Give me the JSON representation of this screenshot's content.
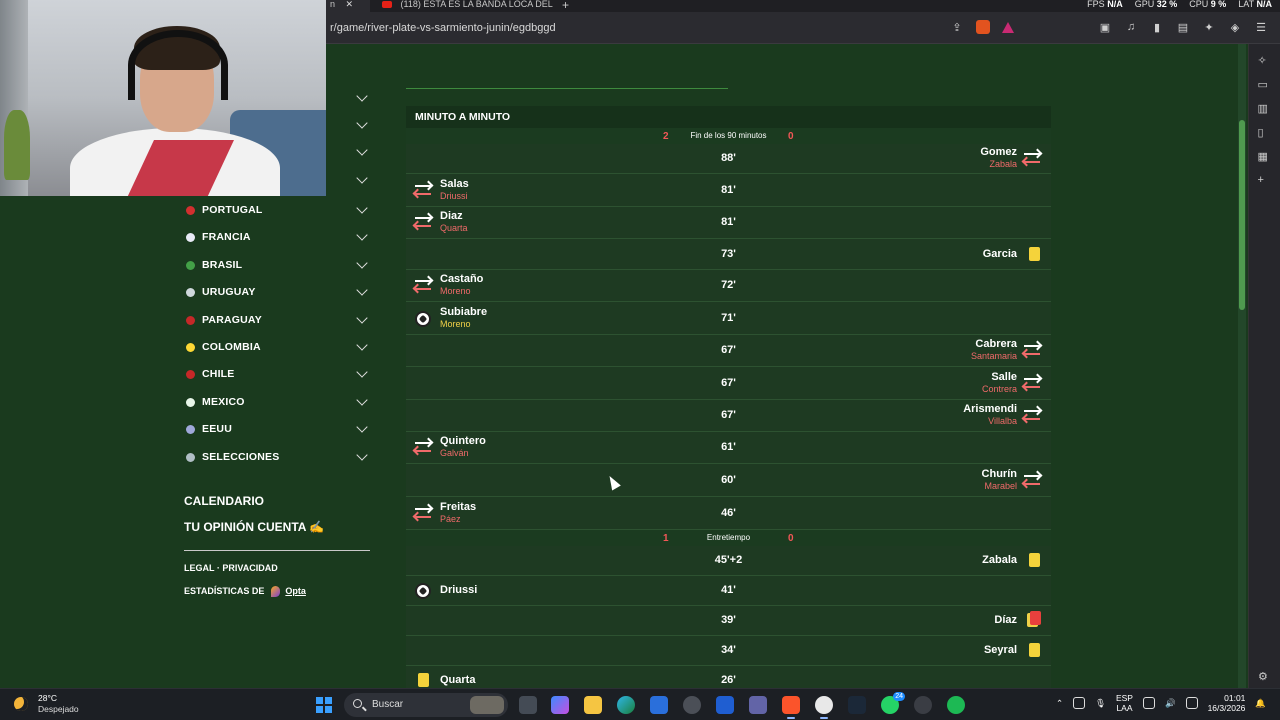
{
  "browser": {
    "tabs": [
      {
        "label": "n",
        "active": true
      },
      {
        "label": "(118) ESTA ES LA BANDA LOCA DEL",
        "active": false
      }
    ],
    "url": "r/game/river-plate-vs-sarmiento-junin/egdbggd",
    "stats": {
      "fps_label": "FPS",
      "fps_value": "N/A",
      "gpu_label": "GPU",
      "gpu_value": "32 %",
      "cpu_label": "CPU",
      "cpu_value": "9 %",
      "lat_label": "LAT",
      "lat_value": "N/A"
    }
  },
  "leftnav": {
    "countries": [
      {
        "label": "PORTUGAL",
        "flag_color": "#d32f2f"
      },
      {
        "label": "FRANCIA",
        "flag_color": "#e8eaf6"
      },
      {
        "label": "BRASIL",
        "flag_color": "#43a047"
      },
      {
        "label": "URUGUAY",
        "flag_color": "#cfd8dc"
      },
      {
        "label": "PARAGUAY",
        "flag_color": "#c62828"
      },
      {
        "label": "COLOMBIA",
        "flag_color": "#fdd835"
      },
      {
        "label": "CHILE",
        "flag_color": "#c62828"
      },
      {
        "label": "MEXICO",
        "flag_color": "#e8f5e9"
      },
      {
        "label": "EEUU",
        "flag_color": "#9fa8da"
      },
      {
        "label": "SELECCIONES",
        "flag_color": "#b0bec5"
      }
    ],
    "calendario": "CALENDARIO",
    "opinion": "TU OPINIÓN CUENTA ✍️",
    "legal": "LEGAL",
    "privacidad": "PRIVACIDAD",
    "stats_by": "ESTADÍSTICAS DE",
    "opta": "Opta"
  },
  "feed": {
    "title": "MINUTO A MINUTO",
    "final": {
      "home": "2",
      "label": "Fin de los 90 minutos",
      "away": "0"
    },
    "halftime": {
      "home": "1",
      "label": "Entretiempo",
      "away": "0"
    },
    "events_a": [
      {
        "min": "88'",
        "side": "away",
        "type": "sub",
        "player": "Gomez",
        "secondary": "Zabala"
      },
      {
        "min": "81'",
        "side": "home",
        "type": "sub",
        "player": "Salas",
        "secondary": "Driussi"
      },
      {
        "min": "81'",
        "side": "home",
        "type": "sub",
        "player": "Diaz",
        "secondary": "Quarta"
      },
      {
        "min": "73'",
        "side": "away",
        "type": "yellow",
        "player": "Garcia",
        "secondary": ""
      },
      {
        "min": "72'",
        "side": "home",
        "type": "sub",
        "player": "Castaño",
        "secondary": "Moreno"
      },
      {
        "min": "71'",
        "side": "home",
        "type": "goal",
        "player": "Subiabre",
        "secondary": "Moreno"
      },
      {
        "min": "67'",
        "side": "away",
        "type": "sub",
        "player": "Cabrera",
        "secondary": "Santamaria"
      },
      {
        "min": "67'",
        "side": "away",
        "type": "sub",
        "player": "Salle",
        "secondary": "Contrera"
      },
      {
        "min": "67'",
        "side": "away",
        "type": "sub",
        "player": "Arismendi",
        "secondary": "Villalba"
      },
      {
        "min": "61'",
        "side": "home",
        "type": "sub",
        "player": "Quintero",
        "secondary": "Galván"
      },
      {
        "min": "60'",
        "side": "away",
        "type": "sub",
        "player": "Churín",
        "secondary": "Marabel"
      },
      {
        "min": "46'",
        "side": "home",
        "type": "sub",
        "player": "Freitas",
        "secondary": "Páez"
      }
    ],
    "events_b": [
      {
        "min": "45'+2",
        "side": "away",
        "type": "yellow",
        "player": "Zabala",
        "secondary": ""
      },
      {
        "min": "41'",
        "side": "home",
        "type": "goal",
        "player": "Driussi",
        "secondary": ""
      },
      {
        "min": "39'",
        "side": "away",
        "type": "red",
        "player": "Díaz",
        "secondary": ""
      },
      {
        "min": "34'",
        "side": "away",
        "type": "yellow",
        "player": "Seyral",
        "secondary": ""
      },
      {
        "min": "26'",
        "side": "home",
        "type": "yellow",
        "player": "Quarta",
        "secondary": ""
      }
    ]
  },
  "taskbar": {
    "temp": "28°C",
    "weather": "Despejado",
    "search_placeholder": "Buscar",
    "lang": "ESP",
    "lang2": "LAA",
    "time": "01:01",
    "date": "16/3/2026",
    "whatsapp_badge": "24"
  },
  "colors": {
    "page_bg": "#1a3a1e",
    "event_row": "#1e3a22",
    "secondary_text": "#f06a6a",
    "yellow_card": "#f5d33b",
    "red_card": "#e8403d"
  }
}
